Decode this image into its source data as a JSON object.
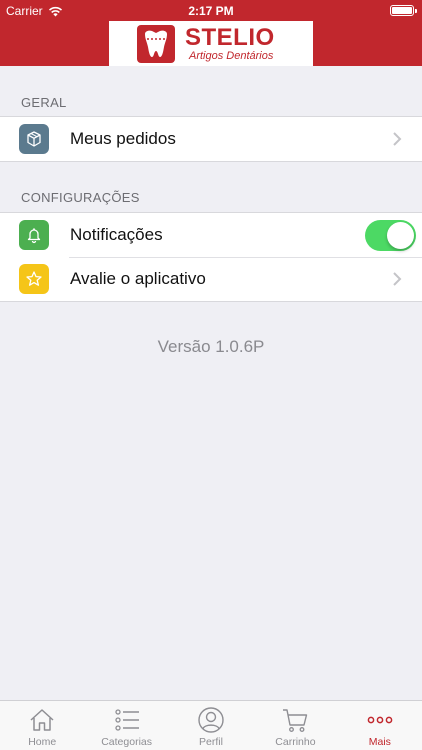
{
  "status_bar": {
    "carrier": "Carrier",
    "time": "2:17 PM"
  },
  "header": {
    "brand_name": "STELIO",
    "brand_subtitle": "Artigos Dentários",
    "color": "#c1272d"
  },
  "sections": {
    "geral": {
      "title": "GERAL",
      "items": [
        {
          "label": "Meus pedidos",
          "icon": "box-icon",
          "icon_color": "#5b7a8e"
        }
      ]
    },
    "configuracoes": {
      "title": "CONFIGURAÇÕES",
      "items": [
        {
          "label": "Notificações",
          "icon": "bell-icon",
          "icon_color": "#4caf50",
          "toggle_on": true
        },
        {
          "label": "Avalie o aplicativo",
          "icon": "star-icon",
          "icon_color": "#f5c518"
        }
      ]
    }
  },
  "version_text": "Versão 1.0.6P",
  "tabbar": {
    "active": "Mais",
    "tabs": [
      {
        "label": "Home",
        "icon": "home-icon"
      },
      {
        "label": "Categorias",
        "icon": "list-icon"
      },
      {
        "label": "Perfil",
        "icon": "profile-icon"
      },
      {
        "label": "Carrinho",
        "icon": "cart-icon"
      },
      {
        "label": "Mais",
        "icon": "more-icon"
      }
    ]
  }
}
